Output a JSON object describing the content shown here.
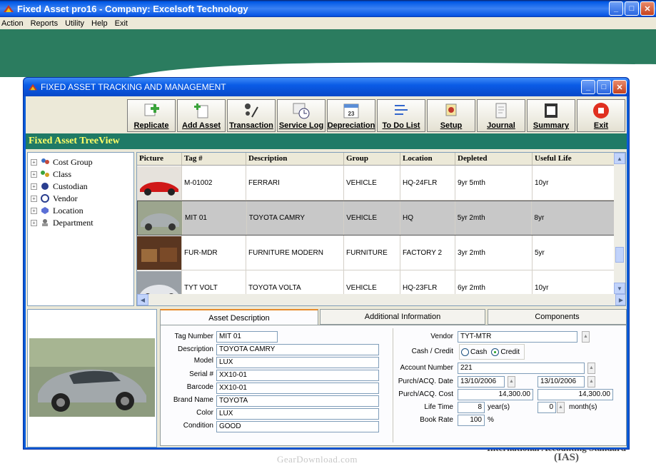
{
  "app": {
    "title": "Fixed Asset pro16 - Company:  Excelsoft Technology",
    "menu": [
      "Action",
      "Reports",
      "Utility",
      "Help",
      "Exit"
    ]
  },
  "window": {
    "title": "FIXED ASSET TRACKING AND MANAGEMENT"
  },
  "toolbar": {
    "buttons": [
      {
        "label": "Replicate",
        "icon": "replicate-icon"
      },
      {
        "label": "Add Asset",
        "icon": "add-asset-icon"
      },
      {
        "label": "Transaction",
        "icon": "transaction-icon"
      },
      {
        "label": "Service Log",
        "icon": "service-log-icon"
      },
      {
        "label": "Depreciation",
        "icon": "calendar-icon"
      },
      {
        "label": "To Do List",
        "icon": "todo-icon"
      },
      {
        "label": "Setup",
        "icon": "setup-icon"
      },
      {
        "label": "Journal",
        "icon": "journal-icon"
      },
      {
        "label": "Summary",
        "icon": "summary-icon"
      },
      {
        "label": "Exit",
        "icon": "exit-icon"
      }
    ]
  },
  "treeview": {
    "header": "Fixed Asset TreeView",
    "items": [
      "Cost Group",
      "Class",
      "Custodian",
      "Vendor",
      "Location",
      "Department"
    ]
  },
  "grid": {
    "columns": [
      "Picture",
      "Tag #",
      "Description",
      "Group",
      "Location",
      "Depleted",
      "Useful Life"
    ],
    "rows": [
      {
        "tag": "M-01002",
        "description": "FERRARI",
        "group": "VEHICLE",
        "location": "HQ-24FLR",
        "depleted": "9yr 5mth",
        "useful_life": "10yr"
      },
      {
        "tag": "MIT 01",
        "description": "TOYOTA CAMRY",
        "group": "VEHICLE",
        "location": "HQ",
        "depleted": "5yr 2mth",
        "useful_life": "8yr"
      },
      {
        "tag": "FUR-MDR",
        "description": "FURNITURE MODERN",
        "group": "FURNITURE",
        "location": "FACTORY 2",
        "depleted": "3yr 2mth",
        "useful_life": "5yr"
      },
      {
        "tag": "TYT VOLT",
        "description": "TOYOTA VOLTA",
        "group": "VEHICLE",
        "location": "HQ-23FLR",
        "depleted": "6yr 2mth",
        "useful_life": "10yr"
      }
    ]
  },
  "tabs": [
    "Asset Description",
    "Additional Information",
    "Components"
  ],
  "asset": {
    "labels": {
      "tag": "Tag Number",
      "description": "Description",
      "model": "Model",
      "serial": "Serial #",
      "barcode": "Barcode",
      "brand": "Brand Name",
      "color": "Color",
      "condition": "Condition",
      "vendor": "Vendor",
      "cash_credit": "Cash / Credit",
      "account": "Account Number",
      "purch_date": "Purch/ACQ. Date",
      "purch_cost": "Purch/ACQ. Cost",
      "life_time": "Life Time",
      "book_rate": "Book Rate",
      "cash": "Cash",
      "credit": "Credit",
      "years": "year(s)",
      "months": "month(s)",
      "pct": "%"
    },
    "tag": "MIT 01",
    "description": "TOYOTA CAMRY",
    "model": "LUX",
    "serial": "XX10-01",
    "barcode": "XX10-01",
    "brand": "TOYOTA",
    "color": "LUX",
    "condition": "GOOD",
    "vendor": "TYT-MTR",
    "payment": "Credit",
    "account": "221",
    "purch_date": "13/10/2006",
    "purch_date2": "13/10/2006",
    "purch_cost": "14,300.00",
    "purch_cost2": "14,300.00",
    "life_years": "8",
    "life_months": "0",
    "book_rate": "100"
  },
  "footer": {
    "watermark": "GearDownload.com",
    "ias": "(IAS)",
    "standard_text": "International Accounting Standard"
  },
  "colors": {
    "titlebar": "#0058e6",
    "tree_header_bg": "#1f7a66",
    "tree_header_text": "#ffff66",
    "banner": "#2b7c5f"
  }
}
